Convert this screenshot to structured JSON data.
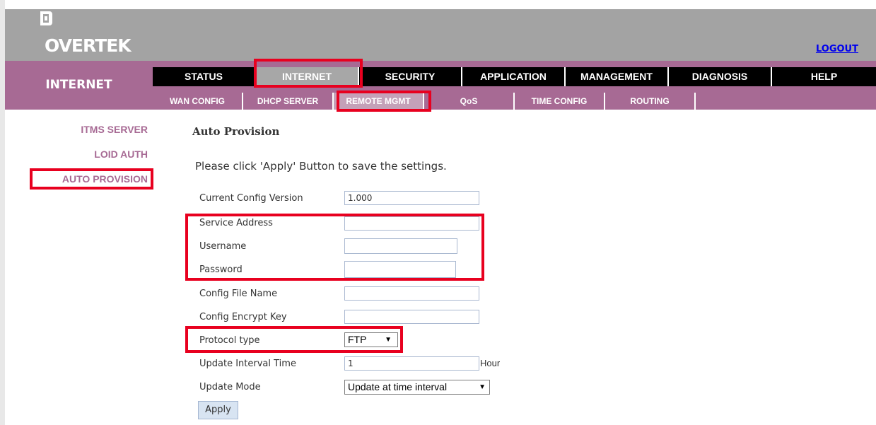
{
  "header": {
    "logo_text": "OVERTEK",
    "logout_label": "LOGOUT"
  },
  "sidebar": {
    "section_title": "INTERNET",
    "items": [
      {
        "label": "ITMS SERVER"
      },
      {
        "label": "LOID AUTH"
      },
      {
        "label": "AUTO PROVISION",
        "selected": true
      }
    ]
  },
  "main_tabs": [
    {
      "label": "STATUS"
    },
    {
      "label": "INTERNET",
      "active": true
    },
    {
      "label": "SECURITY"
    },
    {
      "label": "APPLICATION"
    },
    {
      "label": "MANAGEMENT"
    },
    {
      "label": "DIAGNOSIS"
    },
    {
      "label": "HELP"
    }
  ],
  "sub_tabs": [
    {
      "label": "WAN CONFIG"
    },
    {
      "label": "DHCP SERVER"
    },
    {
      "label": "REMOTE MGMT",
      "active": true
    },
    {
      "label": "QoS"
    },
    {
      "label": "TIME CONFIG"
    },
    {
      "label": "ROUTING"
    }
  ],
  "content": {
    "title": "Auto Provision",
    "instruction": "Please click 'Apply' Button to save the settings.",
    "fields": {
      "current_config_version": {
        "label": "Current Config Version",
        "value": "1.000"
      },
      "service_address": {
        "label": "Service Address",
        "value": ""
      },
      "username": {
        "label": "Username",
        "value": ""
      },
      "password": {
        "label": "Password",
        "value": ""
      },
      "config_file_name": {
        "label": "Config File Name",
        "value": ""
      },
      "config_encrypt_key": {
        "label": "Config Encrypt Key",
        "value": ""
      },
      "protocol_type": {
        "label": "Protocol type",
        "value": "FTP"
      },
      "update_interval_time": {
        "label": "Update Interval Time",
        "value": "1",
        "unit": "Hour"
      },
      "update_mode": {
        "label": "Update Mode",
        "value": "Update at time interval"
      }
    },
    "apply_label": "Apply"
  },
  "colors": {
    "header_gray": "#a3a3a3",
    "brand_purple": "#a76a94",
    "tab_black": "#000000",
    "highlight_red": "#e8001f",
    "link_blue": "#0000ee"
  }
}
